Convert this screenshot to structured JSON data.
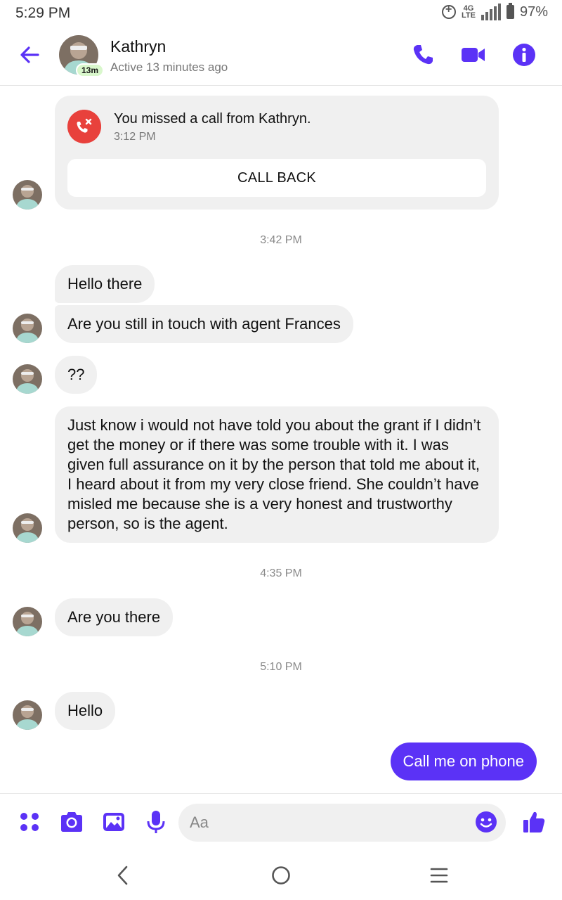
{
  "status_bar": {
    "time": "5:29 PM",
    "network": "4G LTE",
    "battery": "97%"
  },
  "header": {
    "contact_name": "Kathryn",
    "active_badge": "13m",
    "status": "Active 13 minutes ago"
  },
  "missed_call": {
    "text": "You missed a call from Kathryn.",
    "time": "3:12 PM",
    "button_label": "CALL BACK"
  },
  "timestamps": [
    "3:42 PM",
    "4:35 PM",
    "5:10 PM"
  ],
  "messages": [
    {
      "from": "Kathryn",
      "text": "Hello there"
    },
    {
      "from": "Kathryn",
      "text": "Are you still in touch with agent Frances"
    },
    {
      "from": "Kathryn",
      "text": "??"
    },
    {
      "from": "Kathryn",
      "text": "Just know i would not have told you about the grant if I didn’t get the money or if there was some trouble with it. I was given full assurance on it by the person that told me about it, I heard about it from my very close friend. She couldn’t have misled me because she is a very honest and trustworthy person, so is the agent."
    },
    {
      "from": "Kathryn",
      "text": "Are you there"
    },
    {
      "from": "Kathryn",
      "text": "Hello"
    },
    {
      "from": "me",
      "text": "Call me on phone"
    }
  ],
  "composer": {
    "placeholder": "Aa"
  },
  "colors": {
    "accent": "#5b32f6",
    "missed_call_red": "#e8413c",
    "bubble_gray": "#f0f0f0"
  }
}
